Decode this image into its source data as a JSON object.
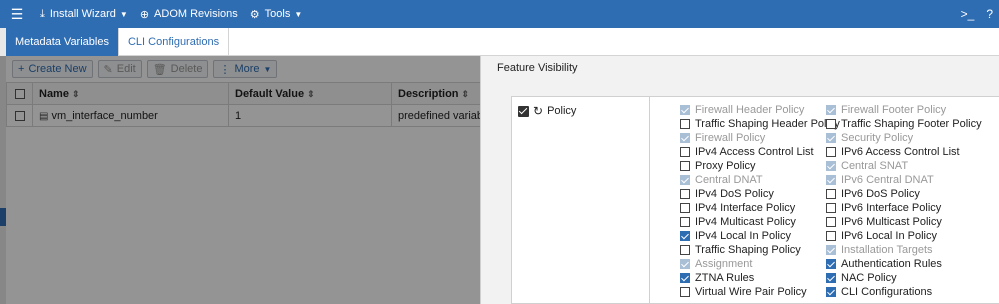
{
  "topbar": {
    "items": [
      {
        "label": "Install Wizard",
        "icon": "download-icon",
        "dropdown": true
      },
      {
        "label": "ADOM Revisions",
        "icon": "globe-icon",
        "dropdown": false
      },
      {
        "label": "Tools",
        "icon": "gear-icon",
        "dropdown": true
      }
    ],
    "right_icons": [
      "terminal-icon",
      "help-icon"
    ],
    "color": "#2f6db3"
  },
  "tabs": [
    {
      "label": "Metadata Variables",
      "active": true
    },
    {
      "label": "CLI Configurations",
      "active": false
    }
  ],
  "toolbar": {
    "create_label": "Create New",
    "edit_label": "Edit",
    "delete_label": "Delete",
    "more_label": "More"
  },
  "table": {
    "columns": [
      "Name",
      "Default Value",
      "Description"
    ],
    "rows": [
      {
        "name": "vm_interface_number",
        "default_value": "1",
        "description": "predefined variabl"
      }
    ]
  },
  "panel": {
    "title": "Feature Visibility",
    "group": {
      "label": "Policy",
      "checked": true
    },
    "features": [
      [
        {
          "label": "Firewall Header Policy",
          "state": "dim"
        },
        {
          "label": "Firewall Footer Policy",
          "state": "dim"
        }
      ],
      [
        {
          "label": "Traffic Shaping Header Policy",
          "state": "unchecked"
        },
        {
          "label": "Traffic Shaping Footer Policy",
          "state": "unchecked"
        }
      ],
      [
        {
          "label": "Firewall Policy",
          "state": "dim"
        },
        {
          "label": "Security Policy",
          "state": "dim"
        }
      ],
      [
        {
          "label": "IPv4 Access Control List",
          "state": "unchecked"
        },
        {
          "label": "IPv6 Access Control List",
          "state": "unchecked"
        }
      ],
      [
        {
          "label": "Proxy Policy",
          "state": "unchecked"
        },
        {
          "label": "Central SNAT",
          "state": "dim"
        }
      ],
      [
        {
          "label": "Central DNAT",
          "state": "dim"
        },
        {
          "label": "IPv6 Central DNAT",
          "state": "dim"
        }
      ],
      [
        {
          "label": "IPv4 DoS Policy",
          "state": "unchecked"
        },
        {
          "label": "IPv6 DoS Policy",
          "state": "unchecked"
        }
      ],
      [
        {
          "label": "IPv4 Interface Policy",
          "state": "unchecked"
        },
        {
          "label": "IPv6 Interface Policy",
          "state": "unchecked"
        }
      ],
      [
        {
          "label": "IPv4 Multicast Policy",
          "state": "unchecked"
        },
        {
          "label": "IPv6 Multicast Policy",
          "state": "unchecked"
        }
      ],
      [
        {
          "label": "IPv4 Local In Policy",
          "state": "checked"
        },
        {
          "label": "IPv6 Local In Policy",
          "state": "unchecked"
        }
      ],
      [
        {
          "label": "Traffic Shaping Policy",
          "state": "unchecked"
        },
        {
          "label": "Installation Targets",
          "state": "dim"
        }
      ],
      [
        {
          "label": "Assignment",
          "state": "dim"
        },
        {
          "label": "Authentication Rules",
          "state": "checked"
        }
      ],
      [
        {
          "label": "ZTNA Rules",
          "state": "checked"
        },
        {
          "label": "NAC Policy",
          "state": "checked"
        }
      ],
      [
        {
          "label": "Virtual Wire Pair Policy",
          "state": "unchecked"
        },
        {
          "label": "CLI Configurations",
          "state": "checked"
        }
      ]
    ]
  }
}
